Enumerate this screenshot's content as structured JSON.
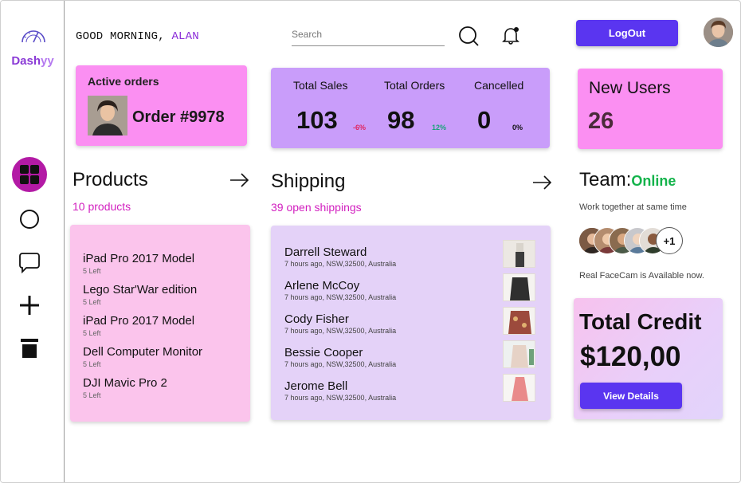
{
  "brand": {
    "name_main": "Dash",
    "name_accent": "yy"
  },
  "header": {
    "greeting": "GOOD MORNING,",
    "user_name": "ALAN",
    "search_placeholder": "Search",
    "logout_label": "LogOut"
  },
  "icons": {
    "logo": "gauge-icon",
    "search": "search-icon",
    "notification": "bell-icon",
    "nav": [
      "dashboard-grid-icon",
      "circle-icon",
      "chat-icon",
      "plus-icon",
      "trash-icon"
    ]
  },
  "active_orders": {
    "title": "Active orders",
    "order_label": "Order #9978"
  },
  "stats": {
    "total_sales_label": "Total Sales",
    "total_sales_value": "103",
    "total_sales_delta": "-6%",
    "total_orders_label": "Total Orders",
    "total_orders_value": "98",
    "total_orders_delta": "12%",
    "cancelled_label": "Cancelled",
    "cancelled_value": "0",
    "cancelled_delta": "0%"
  },
  "new_users": {
    "title": "New Users",
    "value": "26"
  },
  "products": {
    "title": "Products",
    "subtitle": "10 products",
    "items": [
      {
        "name": "iPad Pro 2017 Model",
        "left": "5 Left"
      },
      {
        "name": "Lego Star'War edition",
        "left": "5 Left"
      },
      {
        "name": "iPad Pro 2017 Model",
        "left": "5 Left"
      },
      {
        "name": "Dell Computer Monitor",
        "left": "5 Left"
      },
      {
        "name": "DJI Mavic Pro 2",
        "left": "5 Left"
      }
    ]
  },
  "shipping": {
    "title": "Shipping",
    "subtitle": "39 open shippings",
    "items": [
      {
        "name": "Darrell Steward",
        "meta": "7 hours ago, NSW,32500, Australia"
      },
      {
        "name": "Arlene McCoy",
        "meta": "7 hours ago, NSW,32500, Australia"
      },
      {
        "name": "Cody Fisher",
        "meta": "7 hours ago, NSW,32500, Australia"
      },
      {
        "name": "Bessie Cooper",
        "meta": "7 hours ago, NSW,32500, Australia"
      },
      {
        "name": "Jerome Bell",
        "meta": "7 hours ago, NSW,32500, Australia"
      }
    ]
  },
  "team": {
    "title": "Team:",
    "status": "Online",
    "subtitle": "Work together at same time",
    "more_count": "+1",
    "note": "Real FaceCam is Available now."
  },
  "credit": {
    "title": "Total Credit",
    "amount": "$120,00",
    "button_label": "View Details"
  },
  "colors": {
    "accent": "#5a35f0",
    "pink": "#fb8ff2",
    "lilac": "#c99dfa",
    "online": "#12b34a",
    "magenta": "#d21fbf",
    "negative": "#e0245e",
    "positive": "#1aa37a"
  }
}
